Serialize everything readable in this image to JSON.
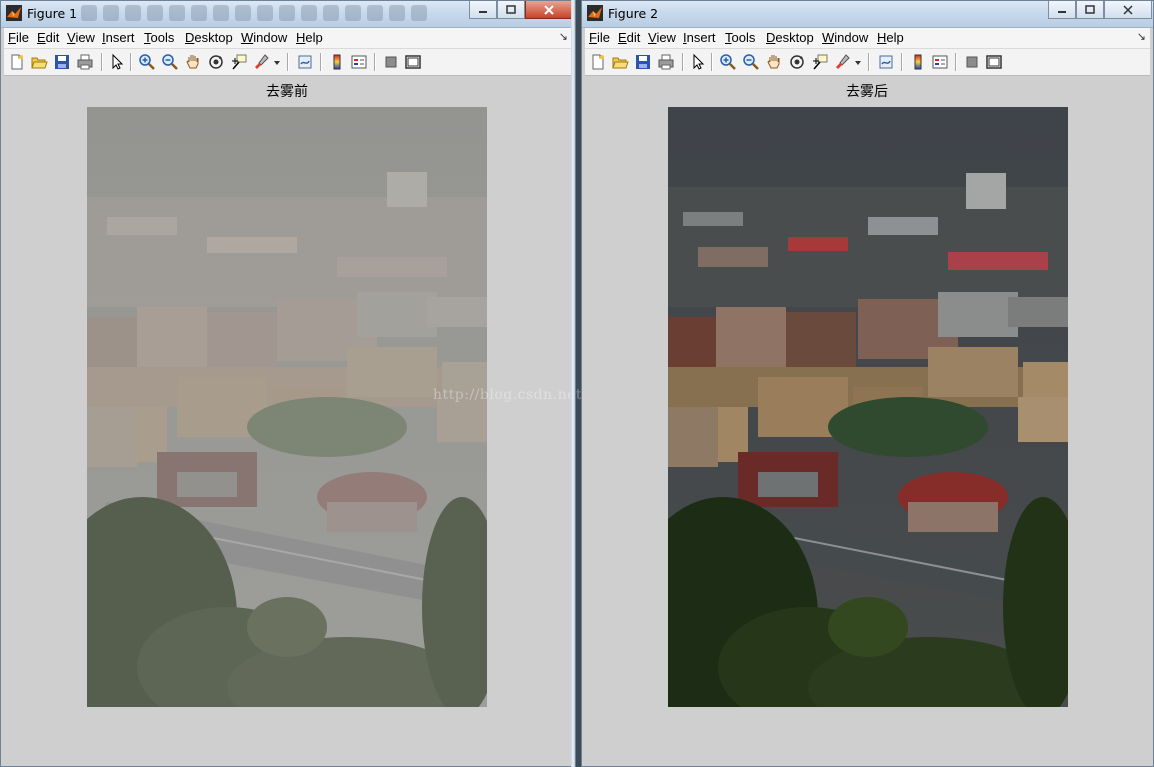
{
  "windows": [
    {
      "title": "Figure 1",
      "menu": [
        "File",
        "Edit",
        "View",
        "Insert",
        "Tools",
        "Desktop",
        "Window",
        "Help"
      ],
      "axes_title": "去雾前",
      "image_variant": "hazy"
    },
    {
      "title": "Figure 2",
      "menu": [
        "File",
        "Edit",
        "View",
        "Insert",
        "Tools",
        "Desktop",
        "Window",
        "Help"
      ],
      "axes_title": "去雾后",
      "image_variant": "dehazed"
    }
  ],
  "toolbar_icons": [
    "new-figure-icon",
    "open-file-icon",
    "save-icon",
    "print-icon",
    "select-pointer-icon",
    "zoom-in-icon",
    "zoom-out-icon",
    "pan-hand-icon",
    "rotate-3d-icon",
    "data-cursor-icon",
    "brush-icon",
    "link-plot-icon",
    "colorbar-icon",
    "legend-icon",
    "hide-plot-tools-icon",
    "show-plot-tools-icon"
  ],
  "watermark": "http://blog.csdn.net/sunzhaoyhb",
  "colors": {
    "figure_background": "#cfcfcf",
    "titlebar": "#c7d9ec",
    "close_button": "#c7432a"
  }
}
